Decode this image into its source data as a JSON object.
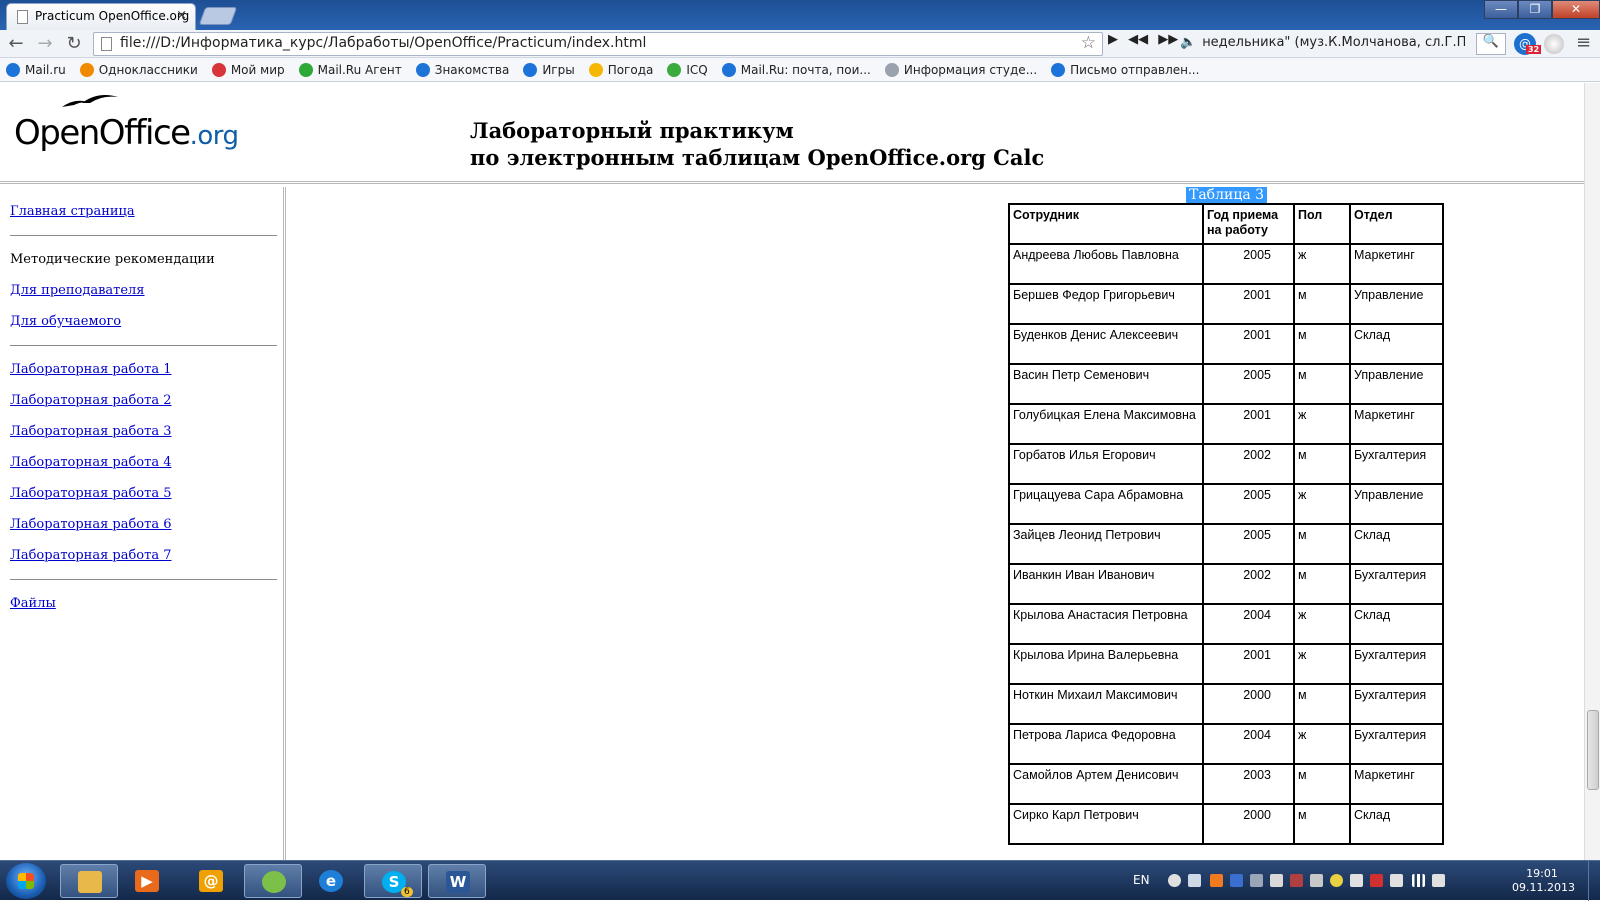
{
  "browser": {
    "tab_title": "Practicum OpenOffice.org",
    "url": "file:///D:/Информатика_курс/Лабработы/OpenOffice/Practicum/index.html",
    "media_track": "недельника\" (муз.К.Молчанова, сл.Г.Полонс",
    "ext_badge": "32",
    "window_buttons": {
      "minimize": "—",
      "maximize": "❐",
      "close": "✕"
    },
    "nav": {
      "back": "←",
      "forward": "→",
      "reload": "↻",
      "menu": "≡"
    }
  },
  "bookmarks": [
    {
      "label": "Mail.ru",
      "color": "#1e73d8"
    },
    {
      "label": "Одноклассники",
      "color": "#f18a00"
    },
    {
      "label": "Мой мир",
      "color": "#d8353a"
    },
    {
      "label": "Mail.Ru Агент",
      "color": "#2ea837"
    },
    {
      "label": "Знакомства",
      "color": "#1e73d8"
    },
    {
      "label": "Игры",
      "color": "#1e73d8"
    },
    {
      "label": "Погода",
      "color": "#f5b700"
    },
    {
      "label": "ICQ",
      "color": "#3caa3c"
    },
    {
      "label": "Mail.Ru: почта, пои...",
      "color": "#1e73d8"
    },
    {
      "label": "Информация студе...",
      "color": "#9aa3ad"
    },
    {
      "label": "Письмо отправлен...",
      "color": "#1e73d8"
    }
  ],
  "header": {
    "logo_main": "OpenOffice",
    "logo_org": ".org",
    "title_line1": "Лабораторный практикум",
    "title_line2": "по электронным таблицам OpenOffice.org Calc"
  },
  "sidebar": {
    "home": "Главная страница",
    "method_heading": "Методические рекомендации",
    "for_teacher": "Для преподавателя",
    "for_student": "Для обучаемого",
    "labs": [
      "Лабораторная работа 1",
      "Лабораторная работа 2",
      "Лабораторная работа 3",
      "Лабораторная работа 4",
      "Лабораторная работа 5",
      "Лабораторная работа 6",
      "Лабораторная работа 7"
    ],
    "files": "Файлы"
  },
  "table": {
    "caption": "Таблица 3",
    "headers": [
      "Сотрудник",
      "Год приема на работу",
      "Пол",
      "Отдел"
    ],
    "rows": [
      [
        "Андреева Любовь Павловна",
        "2005",
        "ж",
        "Маркетинг"
      ],
      [
        "Бершев Федор Григорьевич",
        "2001",
        "м",
        "Управление"
      ],
      [
        "Буденков Денис Алексеевич",
        "2001",
        "м",
        "Склад"
      ],
      [
        "Васин Петр Семенович",
        "2005",
        "м",
        "Управление"
      ],
      [
        "Голубицкая Елена Максимовна",
        "2001",
        "ж",
        "Маркетинг"
      ],
      [
        "Горбатов Илья Егорович",
        "2002",
        "м",
        "Бухгалтерия"
      ],
      [
        "Грицацуева Сара Абрамовна",
        "2005",
        "ж",
        "Управление"
      ],
      [
        "Зайцев Леонид Петрович",
        "2005",
        "м",
        "Склад"
      ],
      [
        "Иванкин Иван Иванович",
        "2002",
        "м",
        "Бухгалтерия"
      ],
      [
        "Крылова Анастасия Петровна",
        "2004",
        "ж",
        "Склад"
      ],
      [
        "Крылова Ирина Валерьевна",
        "2001",
        "ж",
        "Бухгалтерия"
      ],
      [
        "Ноткин Михаил Максимович",
        "2000",
        "м",
        "Бухгалтерия"
      ],
      [
        "Петрова Лариса Федоровна",
        "2004",
        "ж",
        "Бухгалтерия"
      ],
      [
        "Самойлов Артем Денисович",
        "2003",
        "м",
        "Маркетинг"
      ],
      [
        "Сирко Карл Петрович",
        "2000",
        "м",
        "Склад"
      ]
    ]
  },
  "taskbar": {
    "apps": [
      {
        "name": "explorer",
        "color": "#e8b84a",
        "glyph": ""
      },
      {
        "name": "media-player",
        "color": "#e86a1a",
        "glyph": "▶"
      },
      {
        "name": "mail-agent",
        "color": "#f0a000",
        "glyph": "@"
      },
      {
        "name": "browser",
        "color": "#7cc04a",
        "glyph": ""
      },
      {
        "name": "internet-explorer",
        "color": "#1e7fd8",
        "glyph": "e"
      },
      {
        "name": "skype",
        "color": "#00aff0",
        "glyph": "S"
      },
      {
        "name": "word",
        "color": "#2b5797",
        "glyph": "W"
      }
    ],
    "skype_badge": "6",
    "lang": "EN",
    "time": "19:01",
    "date": "09.11.2013"
  }
}
